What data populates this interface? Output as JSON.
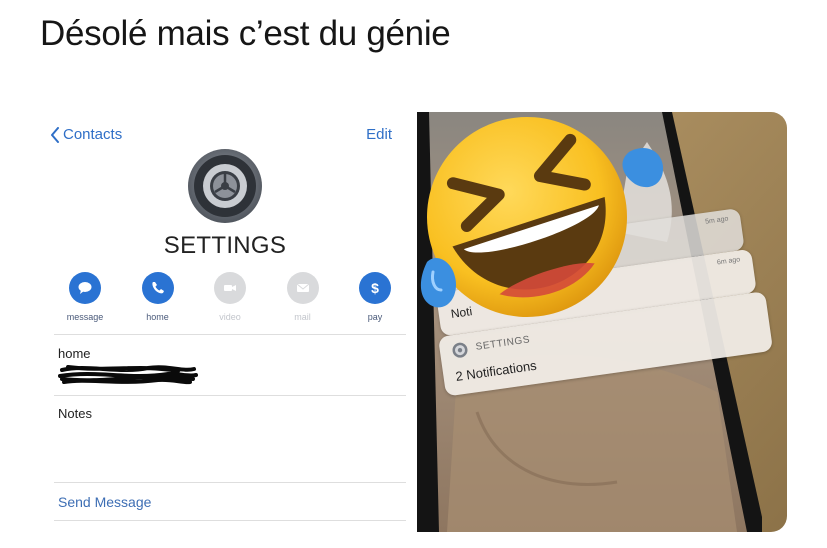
{
  "caption": "Désolé mais c’est du génie",
  "contact_card": {
    "back_label": "Contacts",
    "edit_label": "Edit",
    "name": "SETTINGS",
    "actions": [
      {
        "label": "message",
        "icon": "message-bubble-icon",
        "enabled": true
      },
      {
        "label": "home",
        "icon": "phone-icon",
        "enabled": true
      },
      {
        "label": "video",
        "icon": "video-camera-icon",
        "enabled": false
      },
      {
        "label": "mail",
        "icon": "mail-icon",
        "enabled": false
      },
      {
        "label": "pay",
        "icon": "dollar-icon",
        "enabled": true
      }
    ],
    "phone_label": "home",
    "notes_label": "Notes",
    "send_message": "Send Message"
  },
  "photo": {
    "notif_back_ago": "5m ago",
    "notif_mid_ago": "6m ago",
    "notif_truncated": "Noti",
    "notif_app": "SETTINGS",
    "notif_body": "2 Notifications"
  },
  "colors": {
    "ios_blue": "#2a73d3",
    "link_blue": "#2f6fc7",
    "disabled_gray": "#d9dadc",
    "emoji_yellow": "#f9c021",
    "tear_blue": "#3b8fe0"
  }
}
